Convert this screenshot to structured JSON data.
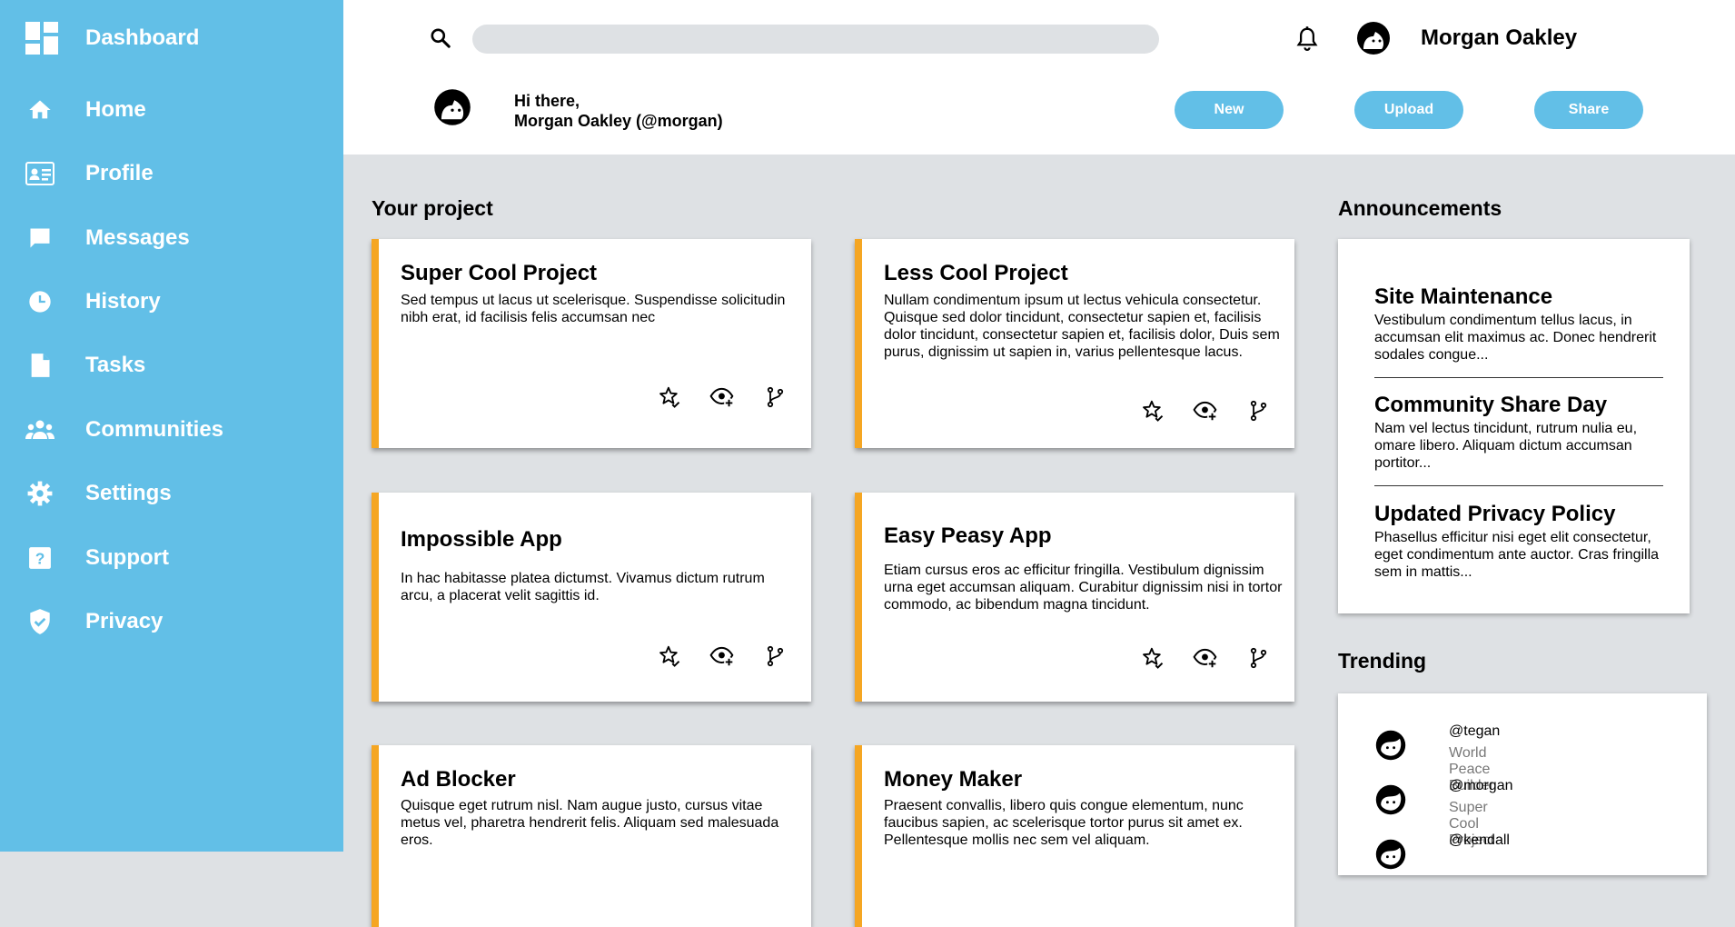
{
  "sidebar": {
    "brand": {
      "label": "Dashboard",
      "icon": "dashboard-icon"
    },
    "items": [
      {
        "label": "Home",
        "icon": "home-icon"
      },
      {
        "label": "Profile",
        "icon": "id-card-icon"
      },
      {
        "label": "Messages",
        "icon": "message-icon"
      },
      {
        "label": "History",
        "icon": "clock-icon"
      },
      {
        "label": "Tasks",
        "icon": "document-icon"
      },
      {
        "label": "Communities",
        "icon": "group-icon"
      },
      {
        "label": "Settings",
        "icon": "gear-icon"
      },
      {
        "label": "Support",
        "icon": "help-icon"
      },
      {
        "label": "Privacy",
        "icon": "shield-icon"
      }
    ]
  },
  "header": {
    "search": {
      "placeholder": "",
      "value": ""
    },
    "username": "Morgan Oakley",
    "greeting_line1": "Hi there,",
    "greeting_line2": "Morgan Oakley (@morgan)",
    "buttons": {
      "new": "New",
      "upload": "Upload",
      "share": "Share"
    }
  },
  "projects": {
    "title": "Your project",
    "cards": [
      {
        "title": "Super Cool Project",
        "desc": "Sed tempus ut lacus ut scelerisque. Suspendisse solicitudin nibh erat, id facilisis felis accumsan nec"
      },
      {
        "title": "Less Cool Project",
        "desc": "Nullam condimentum ipsum ut lectus vehicula consectetur. Quisque sed dolor tincidunt, consectetur sapien et, facilisis dolor tincidunt, consectetur sapien et, facilisis dolor, Duis sem purus, dignissim ut sapien in, varius pellentesque lacus."
      },
      {
        "title": "Impossible App",
        "desc": "In hac habitasse platea dictumst. Vivamus dictum rutrum arcu, a placerat velit sagittis id."
      },
      {
        "title": "Easy Peasy App",
        "desc": "Etiam cursus eros ac efficitur fringilla. Vestibulum dignissim urna eget accumsan aliquam. Curabitur dignissim nisi in tortor commodo, ac bibendum magna tincidunt."
      },
      {
        "title": "Ad Blocker",
        "desc": "Quisque eget rutrum nisl. Nam augue justo, cursus vitae metus vel, pharetra hendrerit felis. Aliquam sed malesuada eros."
      },
      {
        "title": "Money Maker",
        "desc": "Praesent convallis, libero quis congue elementum, nunc faucibus sapien, ac scelerisque tortor purus sit amet ex. Pellentesque mollis nec sem vel aliquam."
      }
    ]
  },
  "announcements": {
    "title": "Announcements",
    "items": [
      {
        "title": "Site Maintenance",
        "body": "Vestibulum condimentum tellus lacus, in accumsan elit maximus ac. Donec hendrerit sodales congue..."
      },
      {
        "title": "Community Share Day",
        "body": "Nam vel lectus tincidunt, rutrum nulia eu, omare libero. Aliquam dictum accumsan portitor..."
      },
      {
        "title": "Updated Privacy Policy",
        "body": "Phasellus efficitur nisi eget elit consectetur, eget condimentum ante auctor. Cras fringilla sem in mattis..."
      }
    ]
  },
  "trending": {
    "title": "Trending",
    "items": [
      {
        "handle": "@tegan",
        "project": "World Peace Builder"
      },
      {
        "handle": "@morgan",
        "project": "Super Cool Project"
      },
      {
        "handle": "@kendall",
        "project": ""
      }
    ]
  },
  "colors": {
    "sidebar": "#62bfe7",
    "accent": "#f5a623",
    "background": "#dee1e4"
  }
}
